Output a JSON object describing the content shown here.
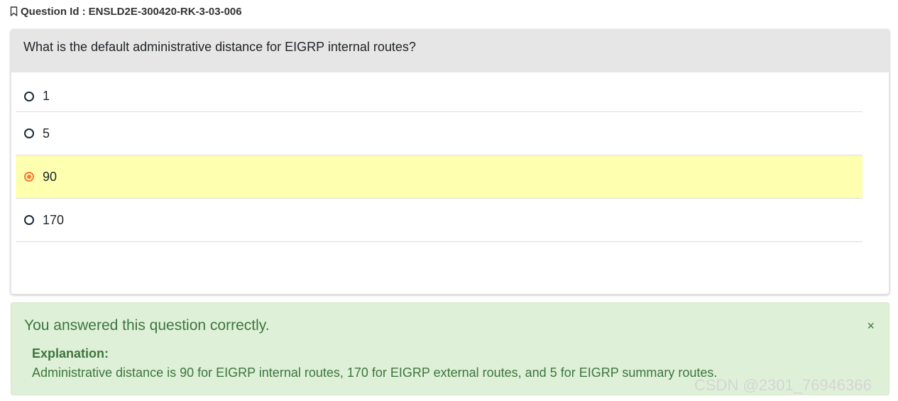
{
  "question_id": {
    "label": "Question Id :",
    "value": "ENSLD2E-300420-RK-3-03-006",
    "icon": "bookmark-icon"
  },
  "question": {
    "text": "What is the default administrative distance for EIGRP internal routes?"
  },
  "options": [
    {
      "label": "1",
      "selected": false
    },
    {
      "label": "5",
      "selected": false
    },
    {
      "label": "90",
      "selected": true
    },
    {
      "label": "170",
      "selected": false
    }
  ],
  "feedback": {
    "message": "You answered this question correctly.",
    "close_label": "×",
    "explanation_title": "Explanation:",
    "explanation_text": "Administrative distance is 90 for EIGRP internal routes, 170 for EIGRP external routes, and 5 for EIGRP summary routes."
  },
  "watermark": "CSDN @2301_76946366",
  "colors": {
    "selected_bg": "#ffffb0",
    "radio_checked": "#f47b36",
    "success_bg": "#dff0d8",
    "success_text": "#3c763d",
    "header_bg": "#e6e6e6"
  }
}
